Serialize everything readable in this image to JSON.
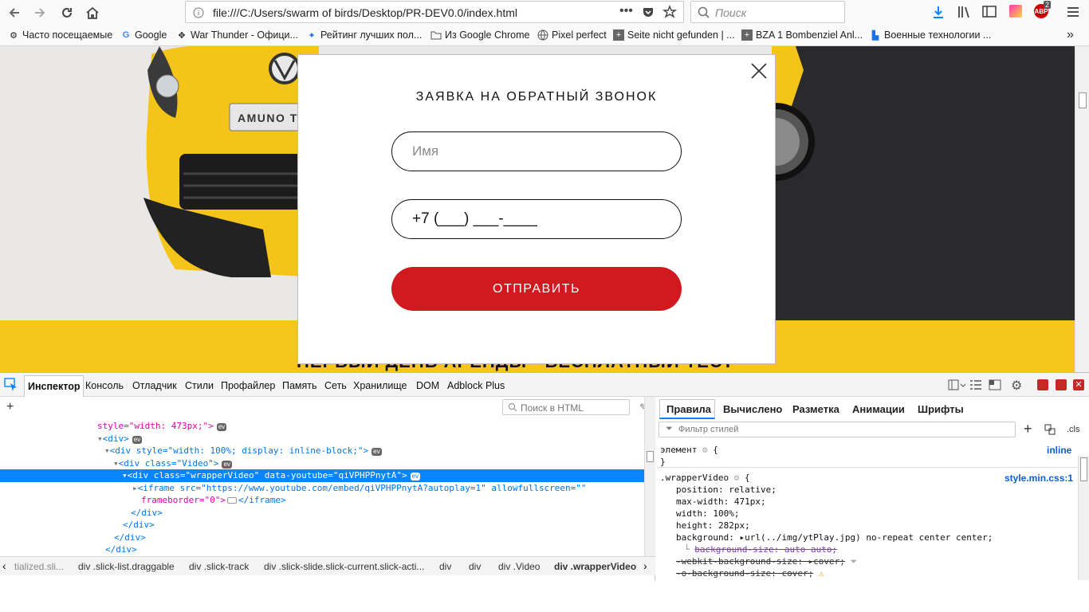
{
  "browser": {
    "url": "file:///C:/Users/swarm of birds/Desktop/PR-DEV0.0/index.html",
    "search_placeholder": "Поиск",
    "adblock_badge": "2",
    "bookmarks": [
      "Часто посещаемые",
      "Google",
      "War Thunder - Офици...",
      "Рейтинг лучших пол...",
      "Из Google Chrome",
      "Pixel perfect",
      "Seite nicht gefunden | ...",
      "BZA 1 Bombenziel Anl...",
      "Военные технологии ..."
    ]
  },
  "page": {
    "car_plate": "AMUNO T",
    "band_text": "ПЕРВЫЙ ДЕНЬ АРЕНДЫ - БЕСПЛАТНЫЙ ТЕСТ",
    "colors": {
      "yellow": "#f7c61e",
      "red": "#d11a1f",
      "dark": "#2a2a2c"
    }
  },
  "modal": {
    "title": "ЗАЯВКА НА ОБРАТНЫЙ ЗВОНОК",
    "name_placeholder": "Имя",
    "phone_mask": "+7 (___) ___-____",
    "submit_label": "ОТПРАВИТЬ"
  },
  "devtools": {
    "tabs": [
      "Инспектор",
      "Консоль",
      "Отладчик",
      "Стили",
      "Профайлер",
      "Память",
      "Сеть",
      "Хранилище",
      "DOM",
      "Adblock Plus"
    ],
    "html_search_placeholder": "Поиск в HTML",
    "breadcrumbs": [
      "tialized.sli...",
      "div .slick-list.draggable",
      "div .slick-track",
      "div .slick-slide.slick-current.slick-acti...",
      "div",
      "div",
      "div .Video",
      "div .wrapperVideo"
    ],
    "right_tabs": [
      "Правила",
      "Вычислено",
      "Разметка",
      "Анимации",
      "Шрифты"
    ],
    "filter_placeholder": "Фильтр стилей",
    "cls_label": ".cls",
    "element_rule": "элемент",
    "inline_label": "inline",
    "selector": ".wrapperVideo",
    "stylesheet": "style.min.css:1",
    "html_lines": [
      "style=\"width: 473px;\">",
      "<div>",
      "<div style=\"width: 100%; display: inline-block;\">",
      "<div class=\"Video\">",
      "<div class=\"wrapperVideo\" data-youtube=\"qiVPHPPnytA\">",
      "<iframe src=\"https://www.youtube.com/embed/qiVPHPPnytA?autoplay=1\" allowfullscreen=\"\"",
      "frameborder=\"0\">",
      "</iframe>",
      "</div>",
      "</div>",
      "</div>",
      "</div>"
    ],
    "css_lines": [
      "position: relative;",
      "max-width: 471px;",
      "width: 100%;",
      "height: 282px;",
      "background: ▸url(../img/ytPlay.jpg) no-repeat center center;",
      "background-size: auto auto;",
      "-webkit-background-size: ▸cover;",
      "-o-background-size: cover;"
    ]
  }
}
